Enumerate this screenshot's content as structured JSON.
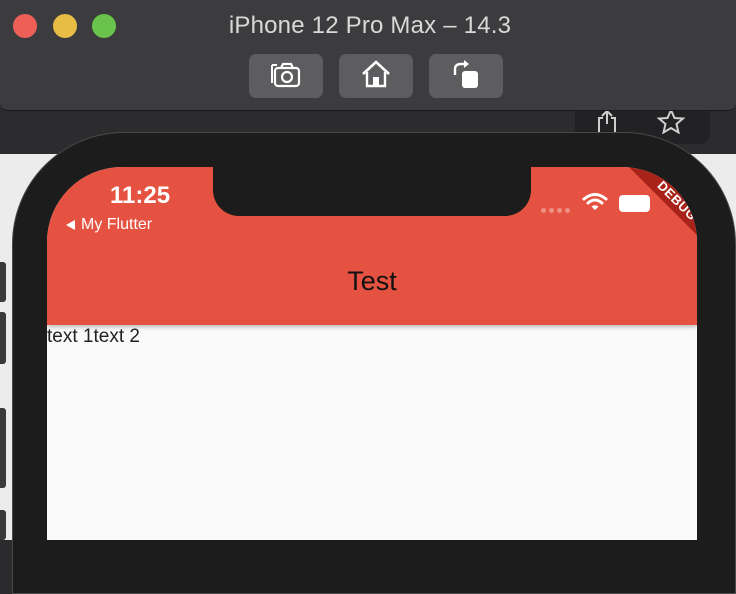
{
  "simulator": {
    "title": "iPhone 12 Pro Max – 14.3",
    "toolbar": [
      {
        "name": "screenshot-icon"
      },
      {
        "name": "home-icon"
      },
      {
        "name": "rotate-icon"
      }
    ]
  },
  "status_bar": {
    "time": "11:25",
    "back_app": "My Flutter",
    "debug_label": "DEBUG"
  },
  "app": {
    "title": "Test",
    "texts": [
      "text 1",
      "text 2"
    ]
  },
  "colors": {
    "appbar": "#e55241",
    "debug_banner": "#a8241a",
    "screen_bg": "#fafafa"
  }
}
